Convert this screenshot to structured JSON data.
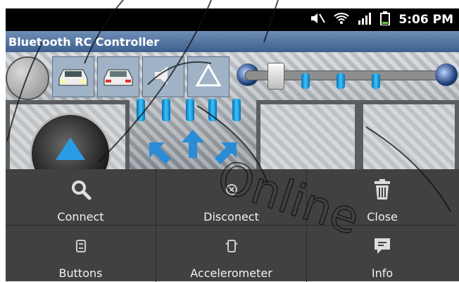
{
  "status_bar": {
    "time": "5:06 PM"
  },
  "app": {
    "title": "Bluetooth RC Controller"
  },
  "menu": {
    "items": [
      {
        "label": "Connect",
        "icon": "search-icon"
      },
      {
        "label": "Disconect",
        "icon": "disconnect-icon"
      },
      {
        "label": "Close",
        "icon": "trash-icon"
      },
      {
        "label": "Buttons",
        "icon": "buttons-icon"
      },
      {
        "label": "Accelerometer",
        "icon": "accelerometer-icon"
      },
      {
        "label": "Info",
        "icon": "info-icon"
      }
    ]
  },
  "colors": {
    "title_bar": "#4f6f9c",
    "menu_bg": "#414141",
    "accent_blue": "#1f8fe0"
  }
}
